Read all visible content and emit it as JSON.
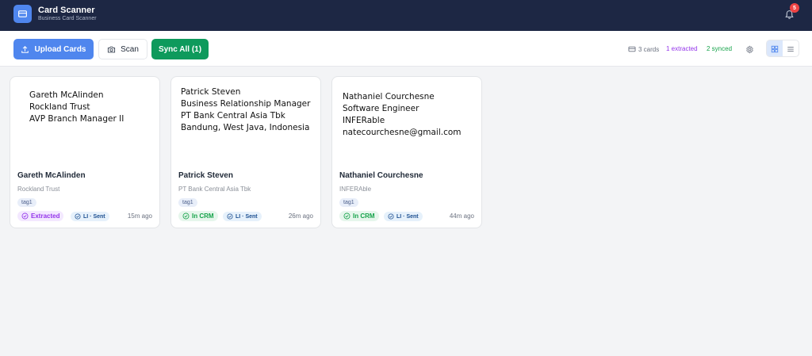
{
  "header": {
    "title": "Card Scanner",
    "subtitle": "Business Card Scanner",
    "notification_count": "5"
  },
  "toolbar": {
    "upload_label": "Upload Cards",
    "scan_label": "Scan",
    "sync_label": "Sync All (1)",
    "stats": {
      "cards": "3 cards",
      "extracted": "1 extracted",
      "synced": "2 synced"
    },
    "view_mode": "grid"
  },
  "colors": {
    "header_bg": "#1d2744",
    "accent": "#4f86ee",
    "sync_green": "#0e9a5c",
    "extracted_purple": "#9333ea",
    "crm_green": "#16a34a"
  },
  "cards": [
    {
      "image_lines": [
        "Gareth McAlinden",
        "Rockland Trust",
        "AVP Branch Manager II"
      ],
      "name": "Gareth McAlinden",
      "company": "Rockland Trust",
      "tag": "tag1",
      "status": "Extracted",
      "status_type": "extracted",
      "li": "LI · Sent",
      "time": "15m ago"
    },
    {
      "image_lines": [
        "Patrick Steven",
        "Business Relationship Manager",
        "PT Bank Central Asia Tbk",
        "Bandung, West Java, Indonesia"
      ],
      "name": "Patrick Steven",
      "company": "PT Bank Central Asia Tbk",
      "tag": "tag1",
      "status": "In CRM",
      "status_type": "crm",
      "li": "LI · Sent",
      "time": "26m ago"
    },
    {
      "image_lines": [
        "Nathaniel Courchesne",
        "Software Engineer",
        "INFERable",
        "natecourchesne@gmail.com"
      ],
      "name": "Nathaniel Courchesne",
      "company": "INFERAble",
      "tag": "tag1",
      "status": "In CRM",
      "status_type": "crm",
      "li": "LI · Sent",
      "time": "44m ago"
    }
  ]
}
